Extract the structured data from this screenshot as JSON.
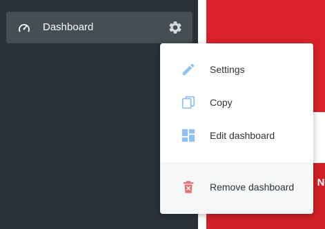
{
  "sidebar": {
    "nav_item": {
      "label": "Dashboard",
      "icon": "speedometer-icon",
      "settings_icon": "gear-icon"
    }
  },
  "context_menu": {
    "items": [
      {
        "label": "Settings",
        "icon": "pencil-icon"
      },
      {
        "label": "Copy",
        "icon": "copy-icon"
      },
      {
        "label": "Edit dashboard",
        "icon": "dashboard-layout-icon"
      }
    ],
    "footer_item": {
      "label": "Remove dashboard",
      "icon": "trash-icon"
    }
  },
  "background": {
    "banner_text_fragment": "N"
  },
  "colors": {
    "sidebar_bg": "#283238",
    "nav_item_bg": "#444e53",
    "accent_blue": "#90c2f0",
    "danger_red": "#e57373",
    "banner_red": "#d9222a"
  }
}
